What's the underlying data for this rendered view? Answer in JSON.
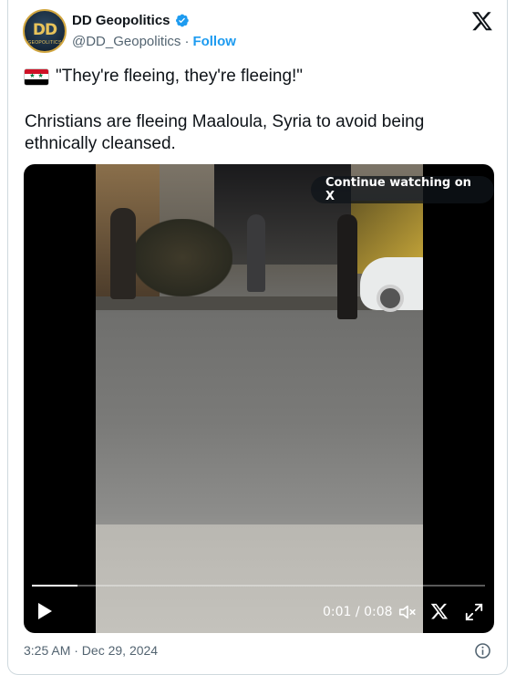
{
  "author": {
    "avatar_text": "DD",
    "avatar_subtext": "GEOPOLITICS",
    "display_name": "DD Geopolitics",
    "handle": "@DD_Geopolitics",
    "separator": "·",
    "follow_label": "Follow",
    "verified_color": "#1d9bf0"
  },
  "post": {
    "flag_icon": "syria-flag-icon",
    "quote": "\"They're fleeing, they're fleeing!\"",
    "text": "Christians are fleeing Maaloula, Syria to avoid being ethnically cleansed."
  },
  "video": {
    "continue_label": "Continue watching on X",
    "current_time": "0:01",
    "time_separator": " / ",
    "duration": "0:08",
    "progress_fraction": 0.1
  },
  "footer": {
    "timestamp": "3:25 AM · Dec 29, 2024"
  },
  "colors": {
    "accent": "#1d9bf0",
    "secondary_text": "#536471",
    "border": "#cfd9de"
  }
}
